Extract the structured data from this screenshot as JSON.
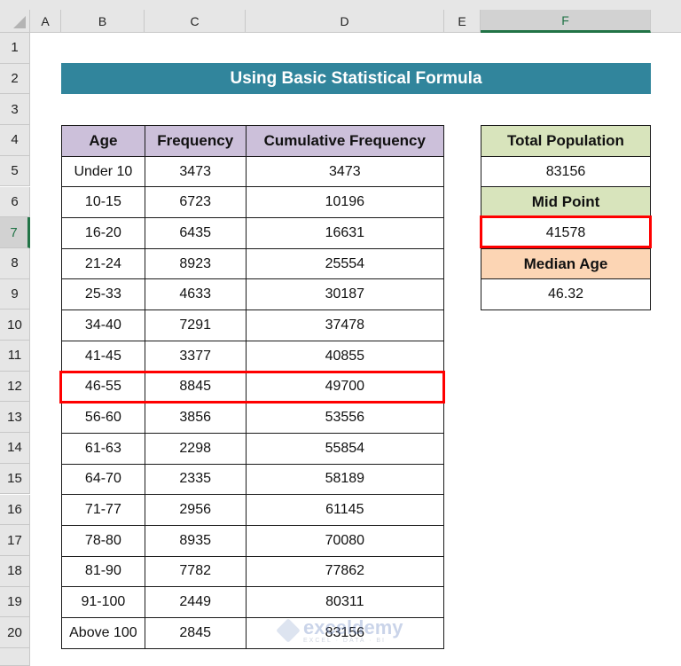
{
  "sheet": {
    "columns": [
      "A",
      "B",
      "C",
      "D",
      "E",
      "F"
    ],
    "selected_column": "F",
    "rows": [
      "1",
      "2",
      "3",
      "4",
      "5",
      "6",
      "7",
      "8",
      "9",
      "10",
      "11",
      "12",
      "13",
      "14",
      "15",
      "16",
      "17",
      "18",
      "19",
      "20"
    ],
    "selected_row": "7"
  },
  "title": "Using Basic Statistical Formula",
  "colors": {
    "banner": "#31859c",
    "main_header_fill": "#ccc0da",
    "total_population_fill": "#d8e4bc",
    "mid_point_fill": "#d8e4bc",
    "median_age_fill": "#fcd5b4",
    "highlight_border": "#ff0000",
    "selection_accent": "#217346"
  },
  "main_table": {
    "headers": [
      "Age",
      "Frequency",
      "Cumulative Frequency"
    ],
    "rows": [
      {
        "age": "Under 10",
        "frequency": "3473",
        "cumulative": "3473"
      },
      {
        "age": "10-15",
        "frequency": "6723",
        "cumulative": "10196"
      },
      {
        "age": "16-20",
        "frequency": "6435",
        "cumulative": "16631"
      },
      {
        "age": "21-24",
        "frequency": "8923",
        "cumulative": "25554"
      },
      {
        "age": "25-33",
        "frequency": "4633",
        "cumulative": "30187"
      },
      {
        "age": "34-40",
        "frequency": "7291",
        "cumulative": "37478"
      },
      {
        "age": "41-45",
        "frequency": "3377",
        "cumulative": "40855"
      },
      {
        "age": "46-55",
        "frequency": "8845",
        "cumulative": "49700"
      },
      {
        "age": "56-60",
        "frequency": "3856",
        "cumulative": "53556"
      },
      {
        "age": "61-63",
        "frequency": "2298",
        "cumulative": "55854"
      },
      {
        "age": "64-70",
        "frequency": "2335",
        "cumulative": "58189"
      },
      {
        "age": "71-77",
        "frequency": "2956",
        "cumulative": "61145"
      },
      {
        "age": "78-80",
        "frequency": "8935",
        "cumulative": "70080"
      },
      {
        "age": "81-90",
        "frequency": "7782",
        "cumulative": "77862"
      },
      {
        "age": "91-100",
        "frequency": "2449",
        "cumulative": "80311"
      },
      {
        "age": "Above 100",
        "frequency": "2845",
        "cumulative": "83156"
      }
    ],
    "highlighted_row_age": "46-55"
  },
  "summary": {
    "total_population_label": "Total Population",
    "total_population_value": "83156",
    "mid_point_label": "Mid Point",
    "mid_point_value": "41578",
    "median_age_label": "Median Age",
    "median_age_value": "46.32"
  },
  "watermark": {
    "name": "exceldemy",
    "tagline": "EXCEL · DATA · BI"
  }
}
